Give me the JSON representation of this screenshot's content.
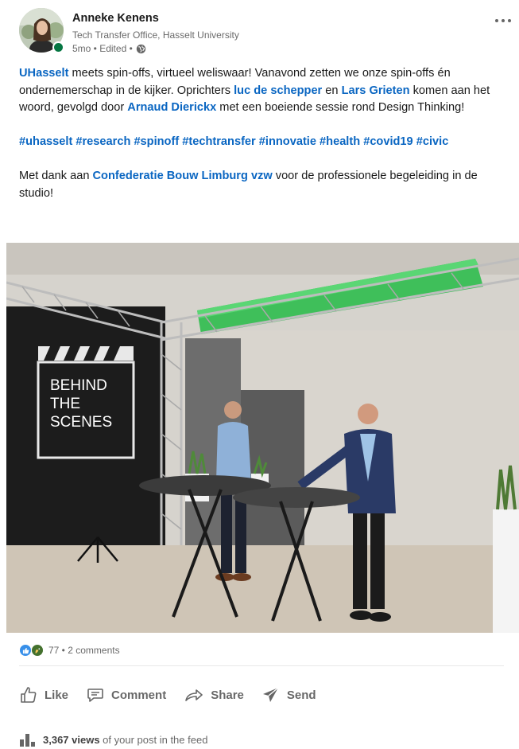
{
  "author": {
    "name": "Anneke Kenens",
    "title": "Tech Transfer Office, Hasselt University",
    "meta": "5mo • Edited •",
    "presence_color": "#057642"
  },
  "post": {
    "p1": {
      "link1": "UHasselt",
      "t1": " meets spin-offs, virtueel weliswaar! Vanavond zetten we onze spin-offs én ondernemerschap in de kijker. Oprichters ",
      "link2": "luc de schepper",
      "t2": " en ",
      "link3": "Lars Grieten",
      "t3": " komen aan het woord, gevolgd door ",
      "link4": "Arnaud Dierickx",
      "t4": " met een boeiende sessie rond Design Thinking!"
    },
    "hashtags": [
      "#uhasselt",
      "#research",
      "#spinoff",
      "#techtransfer",
      "#innovatie",
      "#health",
      "#covid19",
      "#civic"
    ],
    "p3": {
      "t1": "Met dank aan ",
      "link1": "Confederatie Bouw Limburg vzw",
      "t2": " voor de professionele begeleiding in de studio!"
    }
  },
  "photo": {
    "clapperboard_line1": "BEHIND",
    "clapperboard_line2": "THE",
    "clapperboard_line3": "SCENES"
  },
  "social": {
    "reactions_icons": [
      "like-icon",
      "celebrate-icon"
    ],
    "count_text": "77 • 2 comments"
  },
  "actions": {
    "like": "Like",
    "comment": "Comment",
    "share": "Share",
    "send": "Send"
  },
  "views": {
    "count": "3,367 views",
    "suffix": " of your post in the feed"
  },
  "colors": {
    "link": "#0a66c2",
    "like_blue": "#378fe9",
    "celebrate_green": "#44712e"
  }
}
